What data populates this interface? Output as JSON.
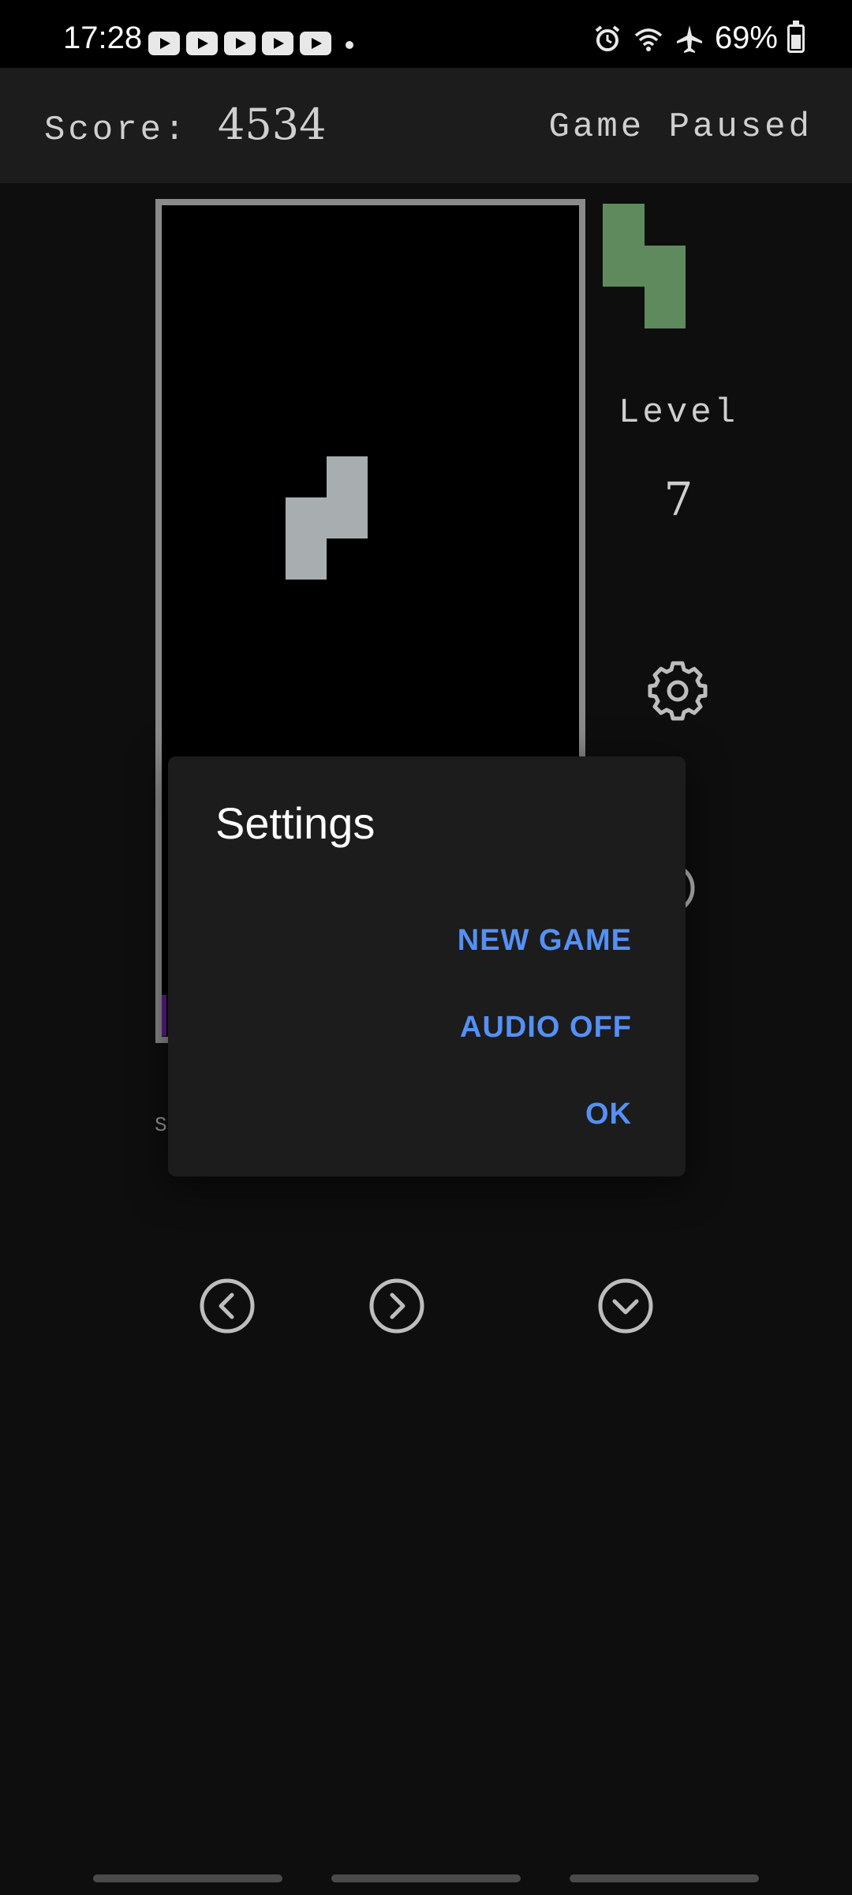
{
  "status_bar": {
    "time": "17:28",
    "battery": "69%",
    "battery_level": 0.69,
    "icons": [
      "youtube-icon",
      "youtube-icon",
      "youtube-icon",
      "youtube-icon",
      "youtube-icon",
      "dot-icon",
      "alarm-icon",
      "wifi-icon",
      "airplane-icon",
      "battery-icon"
    ]
  },
  "header": {
    "score_label": "Score:",
    "score_value": "4534",
    "game_status": "Game Paused"
  },
  "side_panel": {
    "level_label": "Level",
    "level_value": "7",
    "settings_icon": "gear-icon"
  },
  "side_fragment": "S",
  "colors": {
    "background": "#0e0e0e",
    "header": "#1c1c1c",
    "board_border": "#8a8a8a",
    "active_piece": "#a8adb0",
    "next_piece": "#5e8a5e",
    "locked_block": "#5b1e8a",
    "dialog_accent": "#5590f5"
  },
  "dialog": {
    "title": "Settings",
    "buttons": [
      "NEW GAME",
      "AUDIO OFF",
      "OK"
    ]
  },
  "controls": [
    "chevron-left-icon",
    "chevron-right-icon",
    "chevron-down-icon"
  ]
}
